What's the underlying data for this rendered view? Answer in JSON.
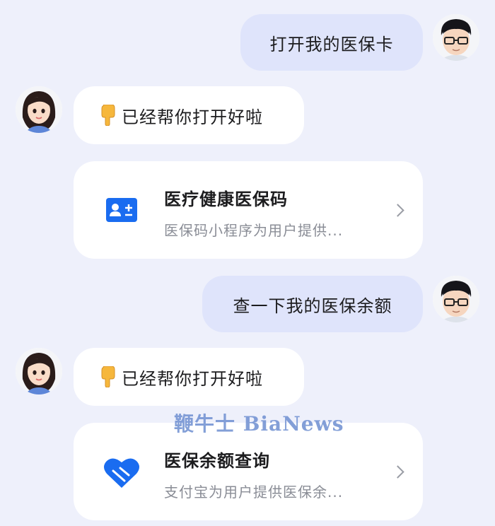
{
  "messages": {
    "user_1": "打开我的医保卡",
    "bot_1": "已经帮你打开好啦",
    "user_2": "查一下我的医保余额",
    "bot_2": "已经帮你打开好啦"
  },
  "cards": [
    {
      "title": "医疗健康医保码",
      "subtitle": "医保码小程序为用户提供...",
      "icon": "id-card-icon"
    },
    {
      "title": "医保余额查询",
      "subtitle": "支付宝为用户提供医保余...",
      "icon": "heart-bandage-icon"
    }
  ],
  "watermark": "鞭牛士 BiaNews",
  "colors": {
    "accent": "#1a6cf0",
    "user_bubble": "#dfe4fb",
    "background": "#eef0fb"
  }
}
